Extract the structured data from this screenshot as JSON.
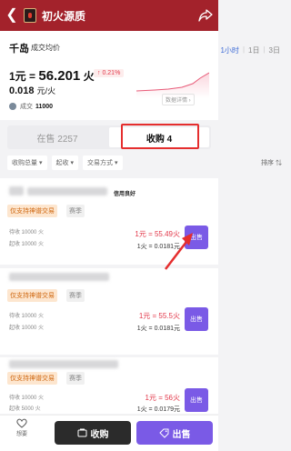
{
  "header": {
    "title": "初火源质"
  },
  "summary": {
    "logo": "千岛",
    "title": "成交均价",
    "ranges": [
      "1小时",
      "1日",
      "3日"
    ],
    "price_prefix": "1元 =",
    "price_value": "56.201",
    "price_unit": "火",
    "change": "↑ 0.21%",
    "price2": "0.018",
    "price2_unit": "元/火",
    "deal_label": "成交",
    "deal_count": "11000",
    "detail_btn": "数据详情 ›"
  },
  "tabs": {
    "selling": "在售 2257",
    "buying": "收购 4"
  },
  "filters": {
    "total": "收购总量",
    "min": "起收",
    "method": "交易方式",
    "sort": "排序 ⇅"
  },
  "items": [
    {
      "good": "信用良好",
      "tag1": "仅支持神谱交易",
      "tag2": "赛季",
      "buy_total": "待收 10000 火",
      "min": "起收 10000 火",
      "ratio": "1元 = 55.49火",
      "unit": "1火 = 0.0181元",
      "sell": "出售"
    },
    {
      "tag1": "仅支持神谱交易",
      "tag2": "赛季",
      "buy_total": "待收 10000 火",
      "min": "起收 10000 火",
      "ratio": "1元 = 55.5火",
      "unit": "1火 = 0.0181元",
      "sell": "出售"
    },
    {
      "tag1": "仅支持神谱交易",
      "tag2": "赛季",
      "buy_total": "待收 10000 火",
      "min": "起收 5000 火",
      "ratio": "1元 = 56火",
      "unit": "1火 = 0.0179元",
      "sell": "出售"
    }
  ],
  "bottom": {
    "want": "想要",
    "buy": "收购",
    "sell": "出售"
  }
}
